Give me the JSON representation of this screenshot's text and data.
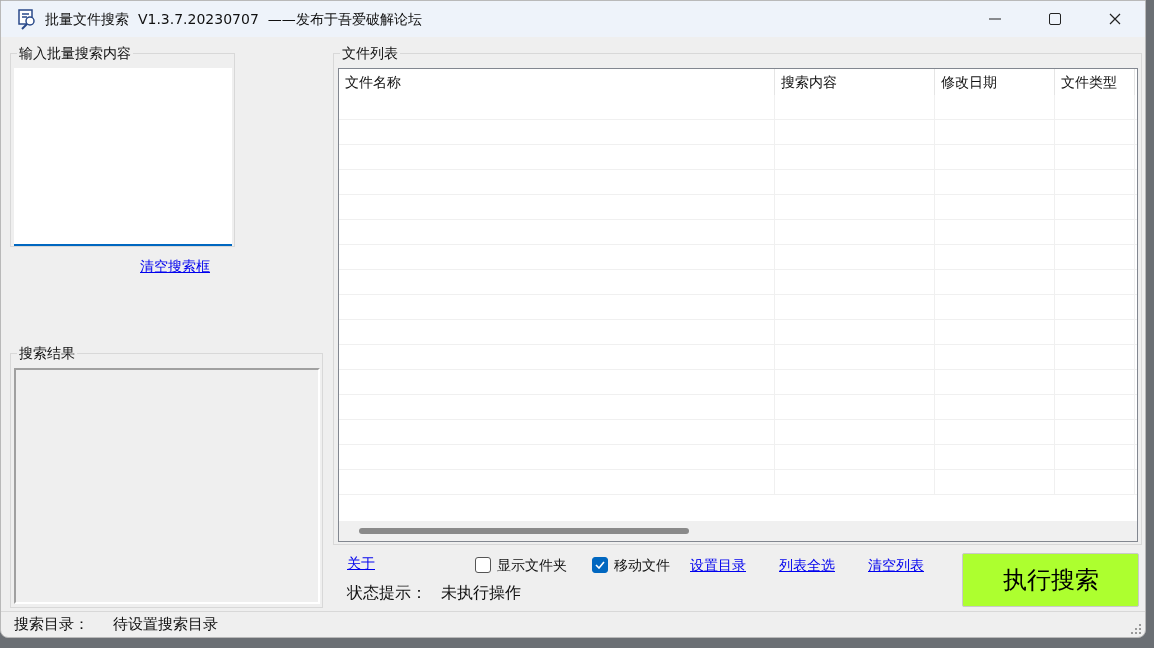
{
  "window": {
    "title": "批量文件搜索  V1.3.7.20230707  ——发布于吾爱破解论坛"
  },
  "search_input": {
    "label": "输入批量搜索内容",
    "clear_link": "清空搜索框"
  },
  "results": {
    "label": "搜索结果"
  },
  "file_list": {
    "label": "文件列表",
    "columns": [
      "文件名称",
      "搜索内容",
      "修改日期",
      "文件类型"
    ]
  },
  "about_link": "关于",
  "options": [
    {
      "label": "显示文件夹",
      "checked": false
    },
    {
      "label": "移动文件",
      "checked": true
    }
  ],
  "links": [
    "设置目录",
    "列表全选",
    "清空列表"
  ],
  "status": {
    "label": "状态提示：",
    "value": "未执行操作"
  },
  "run_button": "执行搜索",
  "status_bar": {
    "label": "搜索目录：",
    "value": "待设置搜索目录"
  }
}
